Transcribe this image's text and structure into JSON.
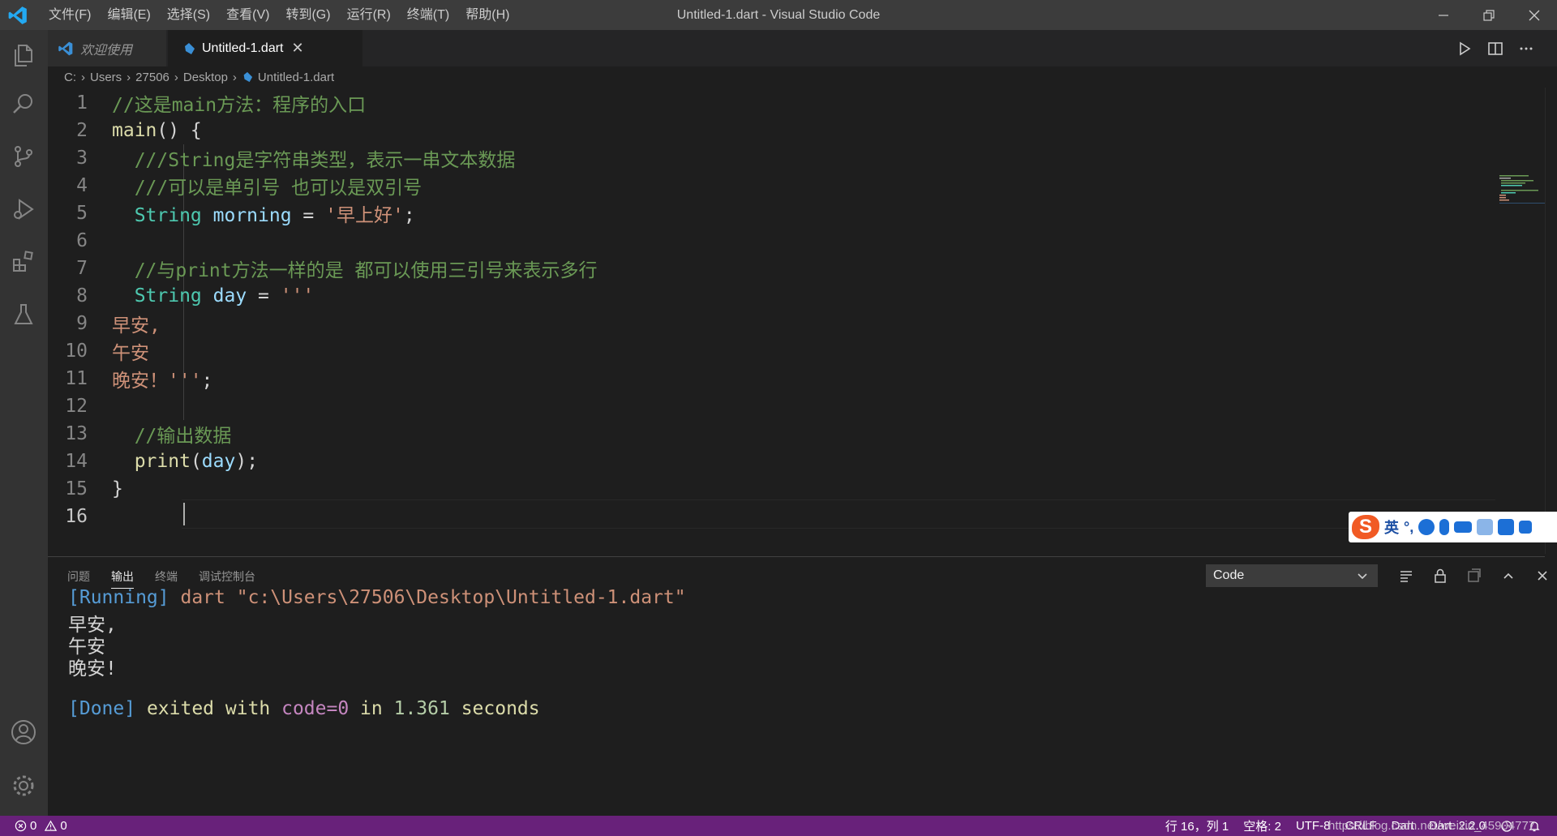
{
  "window": {
    "title": "Untitled-1.dart - Visual Studio Code",
    "menu": [
      "文件(F)",
      "编辑(E)",
      "选择(S)",
      "查看(V)",
      "转到(G)",
      "运行(R)",
      "终端(T)",
      "帮助(H)"
    ]
  },
  "tabs": {
    "welcome": "欢迎使用",
    "active": "Untitled-1.dart"
  },
  "breadcrumb": [
    "C:",
    "Users",
    "27506",
    "Desktop",
    "Untitled-1.dart"
  ],
  "editor": {
    "line_numbers": [
      "1",
      "2",
      "3",
      "4",
      "5",
      "6",
      "7",
      "8",
      "9",
      "10",
      "11",
      "12",
      "13",
      "14",
      "15",
      "16"
    ],
    "l1": "//这是main方法：程序的入口",
    "l2a": "main",
    "l2b": "() {",
    "l3": "  ///String是字符串类型，表示一串文本数据",
    "l4": "  ///可以是单引号 也可以是双引号",
    "l5a": "  String",
    "l5b": " morning",
    "l5c": " = ",
    "l5d": "'早上好'",
    "l5e": ";",
    "l7": "  //与print方法一样的是 都可以使用三引号来表示多行",
    "l8a": "  String",
    "l8b": " day",
    "l8c": " = ",
    "l8d": "'''",
    "l9": "早安,",
    "l10": "午安",
    "l11a": "晚安！'''",
    "l11b": ";",
    "l13": "  //输出数据",
    "l14a": "  print",
    "l14b": "(",
    "l14c": "day",
    "l14d": ");",
    "l15": "}"
  },
  "ime": {
    "logo": "S",
    "mode": "英"
  },
  "panel": {
    "tabs": [
      "问题",
      "输出",
      "终端",
      "调试控制台"
    ],
    "active_tab": "输出",
    "channel": "Code",
    "running_tag": "[Running]",
    "running_cmd": " dart ",
    "running_path": "\"c:\\Users\\27506\\Desktop\\Untitled-1.dart\"",
    "out1": "早安,",
    "out2": "午安",
    "out3": "晚安!",
    "done_tag": "[Done]",
    "done_text1": " exited with ",
    "done_code": "code=0",
    "done_text2": " in ",
    "done_time": "1.361",
    "done_text3": " seconds"
  },
  "status": {
    "errors": "0",
    "warnings": "0",
    "position": "行 16，列 1",
    "spaces": "空格: 2",
    "encoding": "UTF-8",
    "eol": "CRLF",
    "language": "Dart",
    "sdk": "Dart: 2.2.0",
    "watermark": "https://blog.csdn.net/weixin_45904777"
  },
  "colors": {
    "statusbar": "#68217a",
    "titlebar": "#3c3c3c",
    "activitybar": "#333333",
    "editor_bg": "#1e1e1e"
  },
  "icons": [
    "vscode-logo-icon",
    "explorer-icon",
    "search-icon",
    "source-control-icon",
    "run-debug-icon",
    "extensions-icon",
    "testing-icon",
    "account-icon",
    "settings-gear-icon",
    "run-icon",
    "split-editor-icon",
    "more-actions-icon",
    "dart-file-icon",
    "clear-output-icon",
    "lock-icon",
    "open-log-icon",
    "maximize-panel-icon",
    "close-panel-icon",
    "error-icon",
    "warning-icon",
    "feedback-icon",
    "bell-icon"
  ]
}
